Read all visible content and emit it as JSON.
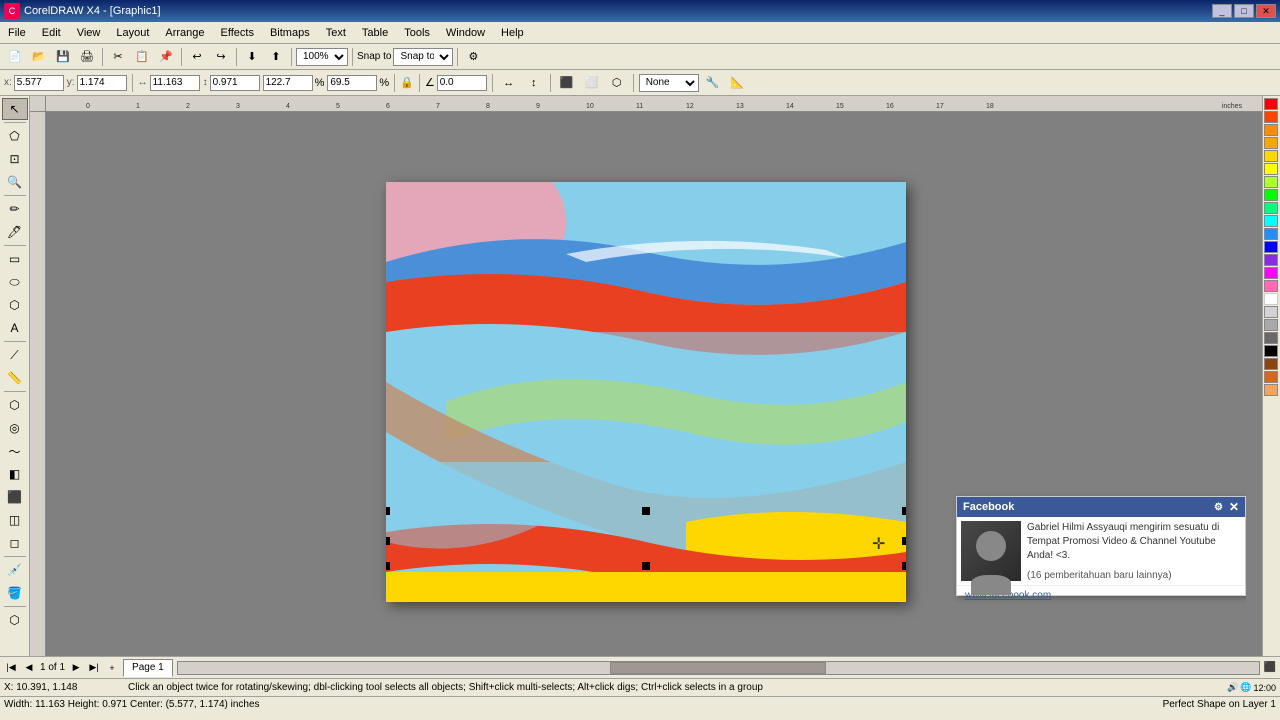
{
  "titlebar": {
    "title": "CorelDRAW X4 - [Graphic1]",
    "icon": "C",
    "buttons": [
      "_",
      "□",
      "✕"
    ]
  },
  "menubar": {
    "items": [
      "File",
      "Edit",
      "View",
      "Layout",
      "Arrange",
      "Effects",
      "Bitmaps",
      "Text",
      "Table",
      "Tools",
      "Window",
      "Help"
    ]
  },
  "toolbar1": {
    "zoom_level": "100%",
    "snap_to": "Snap to"
  },
  "toolbar2": {
    "x_label": "x:",
    "x_value": "5.577",
    "y_label": "y:",
    "y_value": "1.174",
    "w_label": "W:",
    "w_value": "11.163",
    "h_label": "H:",
    "h_value": "0.971",
    "w2_value": "122.7",
    "h2_value": "69.5",
    "angle_value": "0.0",
    "none_label": "None"
  },
  "statusbar": {
    "width_info": "Width: 11.163  Height: 0.971  Center: (5.577, 1.174)  inches",
    "layer_info": "Perfect Shape on Layer 1",
    "coords": "10.391, 1.148",
    "hint": "Click an object twice for rotating/skewing; dbl-clicking tool selects all objects; Shift+click multi-selects; Alt+click digs; Ctrl+click selects in a group"
  },
  "pages": {
    "navigation": "1 of 1",
    "current_page": "Page 1"
  },
  "facebook_popup": {
    "title": "Facebook",
    "message": "Gabriel Hilmi Assyauqi mengirim sesuatu di Tempat Promosi Video & Channel Youtube Anda! <3.",
    "notification_count": "(16 pemberitahuan baru lainnya)",
    "link": "www.facebook.com"
  },
  "colors": {
    "palette": [
      "#FF0000",
      "#FF4500",
      "#FF8C00",
      "#FFA500",
      "#FFD700",
      "#FFFF00",
      "#ADFF2F",
      "#00FF00",
      "#00FF7F",
      "#00FFFF",
      "#1E90FF",
      "#0000FF",
      "#8A2BE2",
      "#FF00FF",
      "#FF69B4",
      "#FFFFFF",
      "#D3D3D3",
      "#A9A9A9",
      "#696969",
      "#000000",
      "#8B4513",
      "#D2691E",
      "#F4A460"
    ]
  }
}
